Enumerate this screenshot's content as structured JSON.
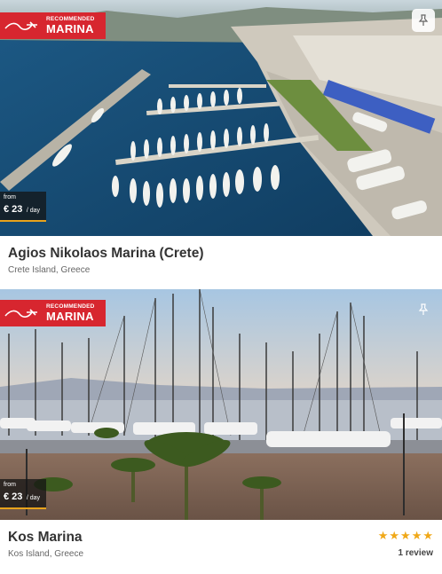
{
  "listings": [
    {
      "badge_small": "RECOMMENDED",
      "badge_big": "MARINA",
      "price_from": "from",
      "price_amount": "€ 23",
      "price_unit": "/ day",
      "title": "Agios Nikolaos Marina (Crete)",
      "location": "Crete Island, Greece",
      "pin_icon": "pin-icon"
    },
    {
      "badge_small": "RECOMMENDED",
      "badge_big": "MARINA",
      "price_from": "from",
      "price_amount": "€ 23",
      "price_unit": "/ day",
      "title": "Kos Marina",
      "location": "Kos Island, Greece",
      "rating": 5,
      "rating_stars": "★★★★★",
      "review_count": "1 review",
      "pin_icon": "pin-icon"
    }
  ],
  "colors": {
    "badge": "#d7262f",
    "star": "#f0a818",
    "price_underline": "#e8a31c"
  }
}
